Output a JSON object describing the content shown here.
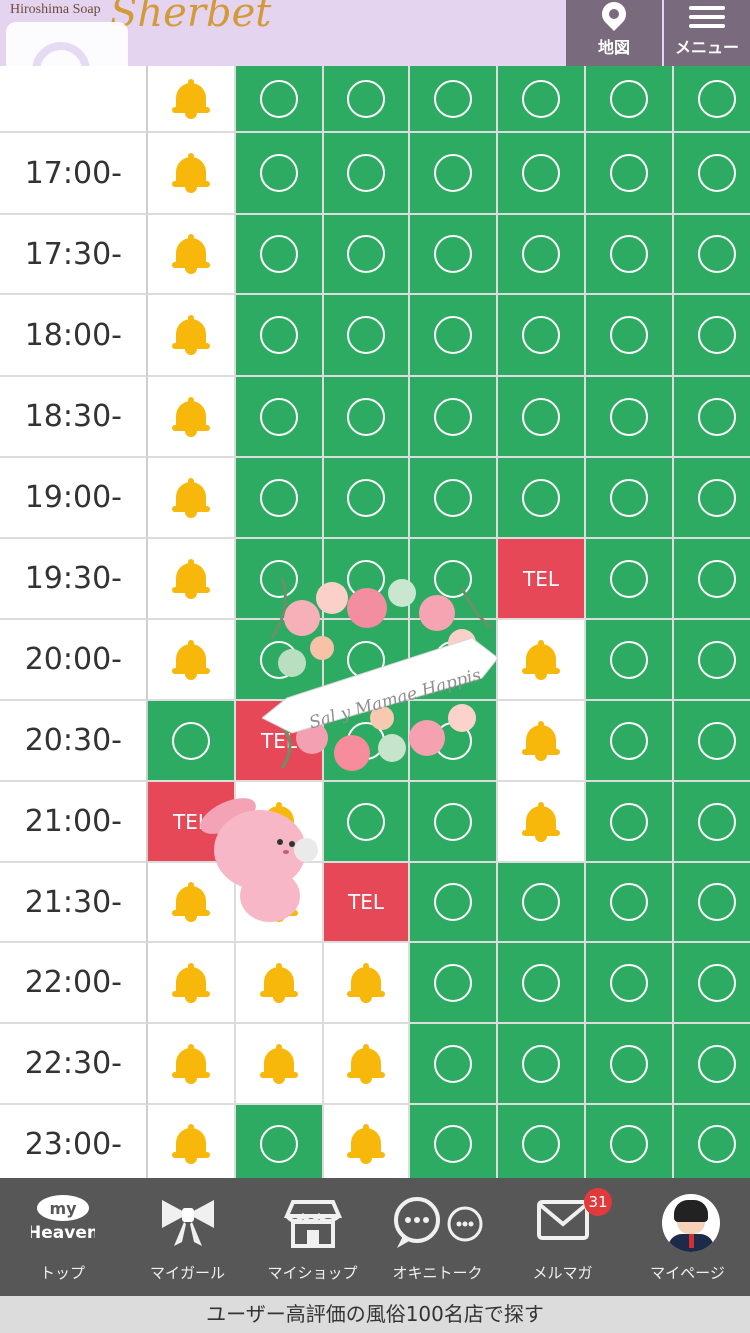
{
  "header": {
    "brand_sub": "Hiroshima Soap",
    "brand_main": "Sherbet",
    "map_label": "地図",
    "menu_label": "メニュー"
  },
  "schedule": {
    "first_time_partial": "1　　　",
    "rows": [
      {
        "time": "",
        "cells": [
          "bell",
          "o",
          "o",
          "o",
          "o",
          "o",
          "o"
        ]
      },
      {
        "time": "17:00-",
        "cells": [
          "bell",
          "o",
          "o",
          "o",
          "o",
          "o",
          "o"
        ]
      },
      {
        "time": "17:30-",
        "cells": [
          "bell",
          "o",
          "o",
          "o",
          "o",
          "o",
          "o"
        ]
      },
      {
        "time": "18:00-",
        "cells": [
          "bell",
          "o",
          "o",
          "o",
          "o",
          "o",
          "o"
        ]
      },
      {
        "time": "18:30-",
        "cells": [
          "bell",
          "o",
          "o",
          "o",
          "o",
          "o",
          "o"
        ]
      },
      {
        "time": "19:00-",
        "cells": [
          "bell",
          "o",
          "o",
          "o",
          "o",
          "o",
          "o"
        ]
      },
      {
        "time": "19:30-",
        "cells": [
          "bell",
          "o",
          "o",
          "o",
          "TEL",
          "o",
          "o"
        ]
      },
      {
        "time": "20:00-",
        "cells": [
          "bell",
          "o",
          "o",
          "o",
          "bell",
          "o",
          "o"
        ]
      },
      {
        "time": "20:30-",
        "cells": [
          "o",
          "TEL",
          "o",
          "o",
          "bell",
          "o",
          "o"
        ]
      },
      {
        "time": "21:00-",
        "cells": [
          "TEL",
          "bell",
          "o",
          "o",
          "bell",
          "o",
          "o"
        ]
      },
      {
        "time": "21:30-",
        "cells": [
          "bell",
          "bell",
          "TEL",
          "o",
          "o",
          "o",
          "o"
        ]
      },
      {
        "time": "22:00-",
        "cells": [
          "bell",
          "bell",
          "bell",
          "o",
          "o",
          "o",
          "o"
        ]
      },
      {
        "time": "22:30-",
        "cells": [
          "bell",
          "bell",
          "bell",
          "o",
          "o",
          "o",
          "o"
        ]
      },
      {
        "time": "23:00-",
        "cells": [
          "bell",
          "o",
          "bell",
          "o",
          "o",
          "o",
          "o"
        ]
      }
    ],
    "tel_label": "TEL"
  },
  "nav": {
    "items": [
      {
        "label": "トップ",
        "icon": "my-heaven-icon"
      },
      {
        "label": "マイガール",
        "icon": "ribbon-icon"
      },
      {
        "label": "マイショップ",
        "icon": "shop-icon"
      },
      {
        "label": "オキニトーク",
        "icon": "chat-icon"
      },
      {
        "label": "メルマガ",
        "icon": "mail-icon"
      },
      {
        "label": "マイページ",
        "icon": "avatar-icon"
      }
    ],
    "mail_badge": "31",
    "my_text": "my",
    "heaven_text": "Heaven"
  },
  "footer": {
    "text": "ユーザー高評価の風俗100名店で探す"
  },
  "stickers": {
    "wreath_text": "Sal y Mamae Happis"
  },
  "colors": {
    "open": "#2eab63",
    "tel": "#e64857",
    "bell": "#f7b80b",
    "header_bg": "#e4d4ef",
    "nav_bg": "#575757"
  }
}
